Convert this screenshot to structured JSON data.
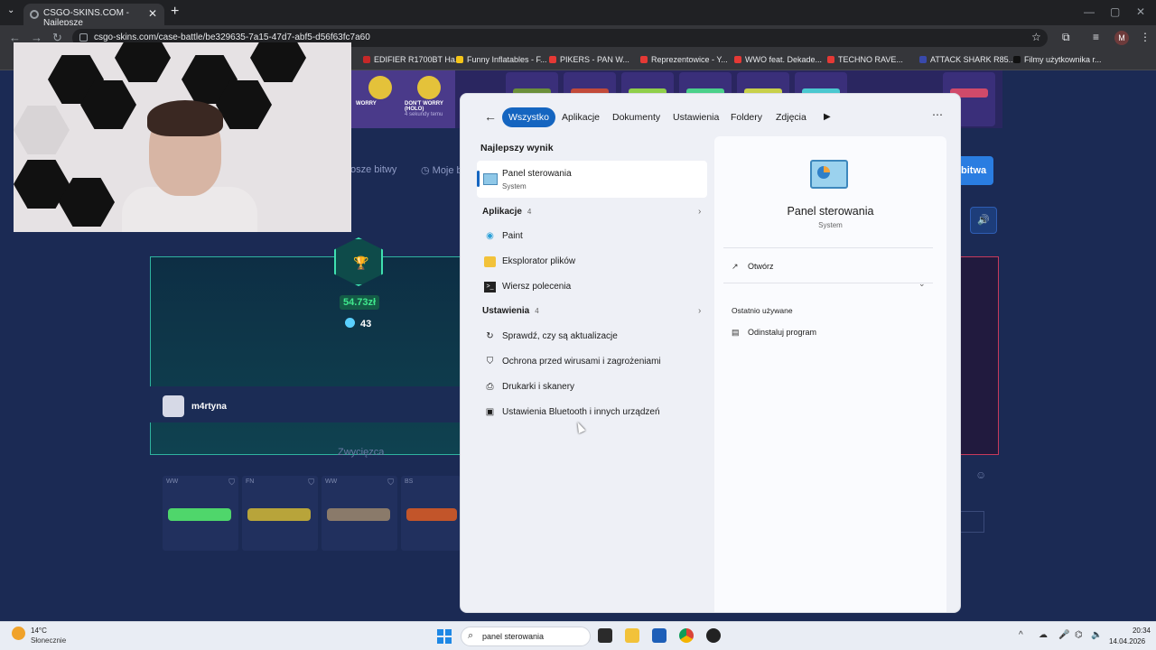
{
  "browser": {
    "tab_title": "CSGO-SKINS.COM - Najlepsze",
    "tab_close": "✕",
    "new_tab": "+",
    "url": "csgo-skins.com/case-battle/be329635-7a15-47d7-abf5-d56f63fc7a60",
    "profile_initial": "M",
    "bookmarks": [
      {
        "label": "EDIFIER R1700BT Ha...",
        "color": "#c62828"
      },
      {
        "label": "Funny Inflatables - F...",
        "color": "#f5c518"
      },
      {
        "label": "PIKERS - PAN W...",
        "color": "#e53935"
      },
      {
        "label": "Reprezentowice - Y...",
        "color": "#e53935"
      },
      {
        "label": "WWO feat. Dekade...",
        "color": "#e53935"
      },
      {
        "label": "TECHNO RAVE...",
        "color": "#e53935"
      },
      {
        "label": "ATTACK SHARK R85...",
        "color": "#3949ab"
      },
      {
        "label": "Filmy użytkownika r...",
        "color": "#111111"
      }
    ]
  },
  "site": {
    "nav_items": [
      "osze bitwy",
      "Moje b"
    ],
    "battle_button": "bitwa",
    "dont_worry": "DON'T WORRY (HOLO)",
    "dont_worry_sub": "4 sekundy temu",
    "worry_small": "WORRY",
    "prize": "54.73zł",
    "coins": "43",
    "player_name": "m4rtyna",
    "winners_label": "Zwycięzca",
    "winner_cards": [
      {
        "quality": "WW",
        "color": "#4fd66b"
      },
      {
        "quality": "FN",
        "color": "#b8a43a"
      },
      {
        "quality": "WW",
        "color": "#8a7a6a"
      },
      {
        "quality": "BS",
        "color": "#c2552a"
      }
    ]
  },
  "search": {
    "tabs": [
      "Wszystko",
      "Aplikacje",
      "Dokumenty",
      "Ustawienia",
      "Foldery",
      "Zdjęcia"
    ],
    "best_result_title": "Najlepszy wynik",
    "best_result": {
      "name": "Panel sterowania",
      "type": "System"
    },
    "apps_title": "Aplikacje",
    "apps_count": "4",
    "apps": [
      {
        "name": "Paint",
        "icon": "paint-icon"
      },
      {
        "name": "Eksplorator plików",
        "icon": "folder-icon"
      },
      {
        "name": "Wiersz polecenia",
        "icon": "terminal-icon"
      }
    ],
    "settings_title": "Ustawienia",
    "settings_count": "4",
    "settings": [
      {
        "name": "Sprawdź, czy są aktualizacje",
        "icon": "refresh-icon"
      },
      {
        "name": "Ochrona przed wirusami i zagrożeniami",
        "icon": "shield-icon"
      },
      {
        "name": "Drukarki i skanery",
        "icon": "printer-icon"
      },
      {
        "name": "Ustawienia Bluetooth i innych urządzeń",
        "icon": "devices-icon"
      }
    ],
    "detail": {
      "title": "Panel sterowania",
      "subtitle": "System",
      "open_action": "Otwórz",
      "recent_title": "Ostatnio używane",
      "recent_item": "Odinstaluj program"
    }
  },
  "taskbar": {
    "temperature": "14°C",
    "weather": "Słonecznie",
    "search_text": "panel sterowania",
    "time": "20:34",
    "date": "14.04.2026"
  }
}
